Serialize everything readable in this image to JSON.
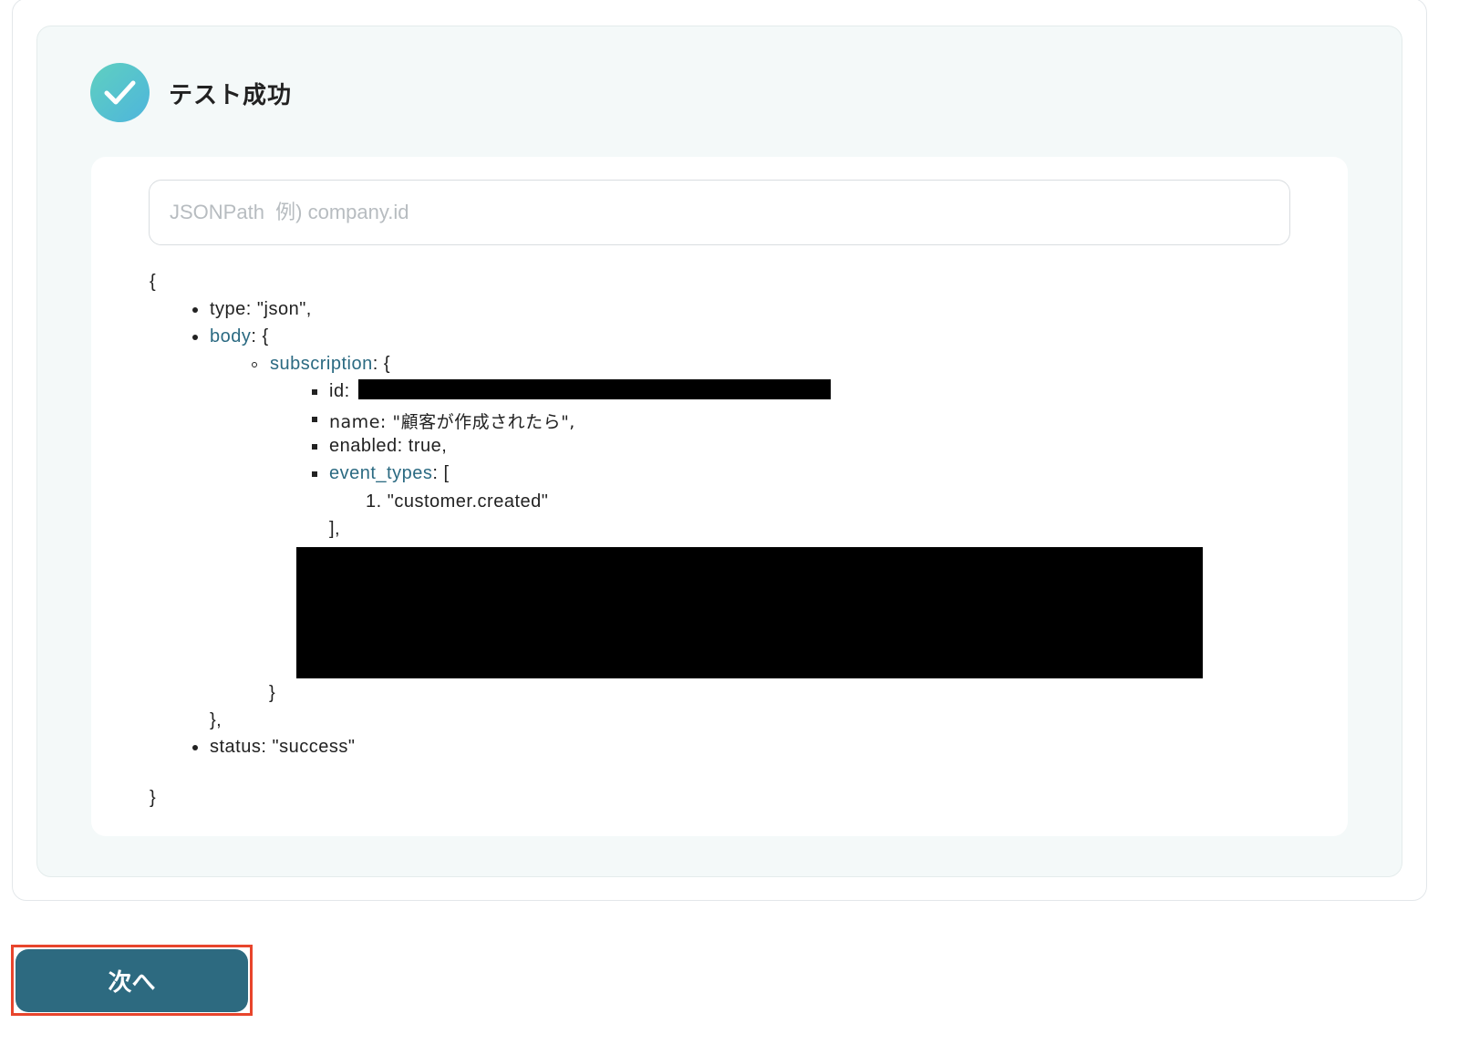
{
  "status": {
    "title": "テスト成功",
    "icon": "check-circle-icon"
  },
  "search": {
    "placeholder": "JSONPath  例) company.id",
    "value": ""
  },
  "json": {
    "open_brace": "{",
    "type_line": "type: \"json\",",
    "body_key": "body",
    "body_suffix": ": {",
    "subscription_key": "subscription",
    "subscription_suffix": ": {",
    "id_label": "id:",
    "name_line": "name: \"顧客が作成されたら\",",
    "enabled_line": "enabled: true,",
    "event_types_key": "event_types",
    "event_types_suffix": ": [",
    "event_item": "1. \"customer.created\"",
    "event_types_close": "],",
    "subscription_close": "}",
    "body_close": "},",
    "status_line": "status: \"success\"",
    "close_brace": "}"
  },
  "footer": {
    "next_label": "次へ"
  },
  "colors": {
    "accent": "#2d6a80",
    "highlight": "#e8452c",
    "key": "#2b6a82"
  }
}
